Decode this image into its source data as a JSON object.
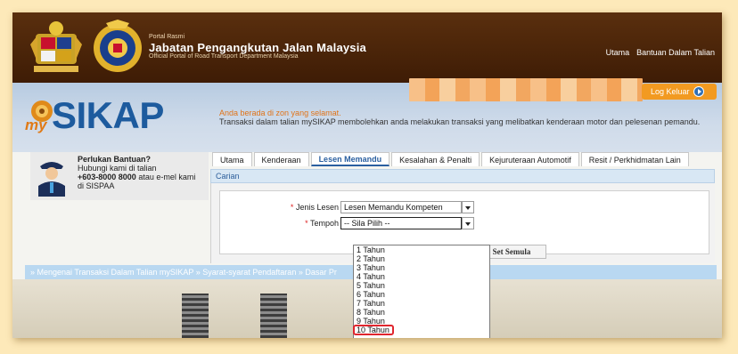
{
  "header": {
    "portal_small": "Portal Rasmi",
    "portal_title": "Jabatan Pengangkutan Jalan Malaysia",
    "portal_sub": "Official Portal of Road Transport Department Malaysia",
    "nav": [
      "Utama",
      "Bantuan Dalam Talian"
    ]
  },
  "banner": {
    "logo_my": "my",
    "logo_sikap": "SIKAP",
    "welcome": "Anda berada di zon yang selamat.",
    "description": "Transaksi dalam talian mySIKAP membolehkan anda melakukan transaksi yang melibatkan kenderaan motor dan pelesenan pemandu.",
    "logout_label": "Log Keluar"
  },
  "help": {
    "title": "Perlukan Bantuan?",
    "line1": "Hubungi kami di talian",
    "phone": "+603-8000 8000",
    "line2_rest": " atau e-mel kami",
    "line3": "di SISPAA"
  },
  "tabs": [
    "Utama",
    "Kenderaan",
    "Lesen Memandu",
    "Kesalahan & Penalti",
    "Kejuruteraan Automotif",
    "Resit / Perkhidmatan Lain"
  ],
  "active_tab": "Lesen Memandu",
  "section_title": "Carian",
  "form": {
    "jenis_label": "Jenis Lesen",
    "jenis_value": "Lesen Memandu Kompeten",
    "tempoh_label": "Tempoh",
    "tempoh_value": "-- Sila Pilih --",
    "required_mark": "*",
    "reset_label": "Set Semula"
  },
  "dropdown_options": [
    "1 Tahun",
    "2 Tahun",
    "3 Tahun",
    "4 Tahun",
    "5 Tahun",
    "6 Tahun",
    "7 Tahun",
    "8 Tahun",
    "9 Tahun",
    "10 Tahun"
  ],
  "highlighted_option": "10 Tahun",
  "footer_links": "» Mengenai Transaksi Dalam Talian mySIKAP » Syarat-syarat Pendaftaran » Dasar Pr",
  "colors": {
    "header_brown": "#4a240a",
    "accent_orange": "#f29a21",
    "brand_blue": "#1d5b9e",
    "highlight_red": "#e0262e"
  }
}
